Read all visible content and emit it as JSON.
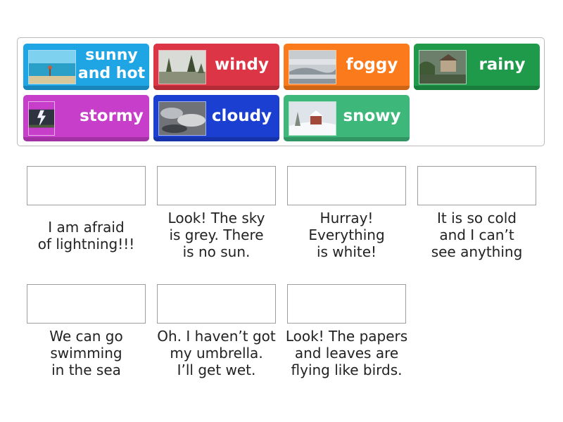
{
  "tiles": [
    {
      "label": "sunny and hot",
      "color": "#1fa4e4",
      "icon": "beach-photo"
    },
    {
      "label": "windy",
      "color": "#dc3545",
      "icon": "windy-trees-photo"
    },
    {
      "label": "foggy",
      "color": "#fb7a1c",
      "icon": "foggy-landscape-photo"
    },
    {
      "label": "rainy",
      "color": "#1f9a4a",
      "icon": "rainy-village-photo"
    },
    {
      "label": "stormy",
      "color": "#c63ec9",
      "icon": "lightning-photo"
    },
    {
      "label": "cloudy",
      "color": "#1b3fd0",
      "icon": "clouds-photo"
    },
    {
      "label": "snowy",
      "color": "#3db77a",
      "icon": "snowy-scene-photo"
    }
  ],
  "clues": [
    {
      "text": "I am afraid\nof lightning!!!"
    },
    {
      "text": "Look! The sky\nis grey. There\nis no sun."
    },
    {
      "text": "Hurray!\nEverything\nis white!"
    },
    {
      "text": "It is so cold\nand I can’t\nsee anything"
    },
    {
      "text": "We can go\nswimming\nin the sea"
    },
    {
      "text": "Oh. I haven’t got\nmy umbrella.\nI’ll get wet."
    },
    {
      "text": "Look! The papers\nand leaves are\nflying like birds."
    }
  ]
}
